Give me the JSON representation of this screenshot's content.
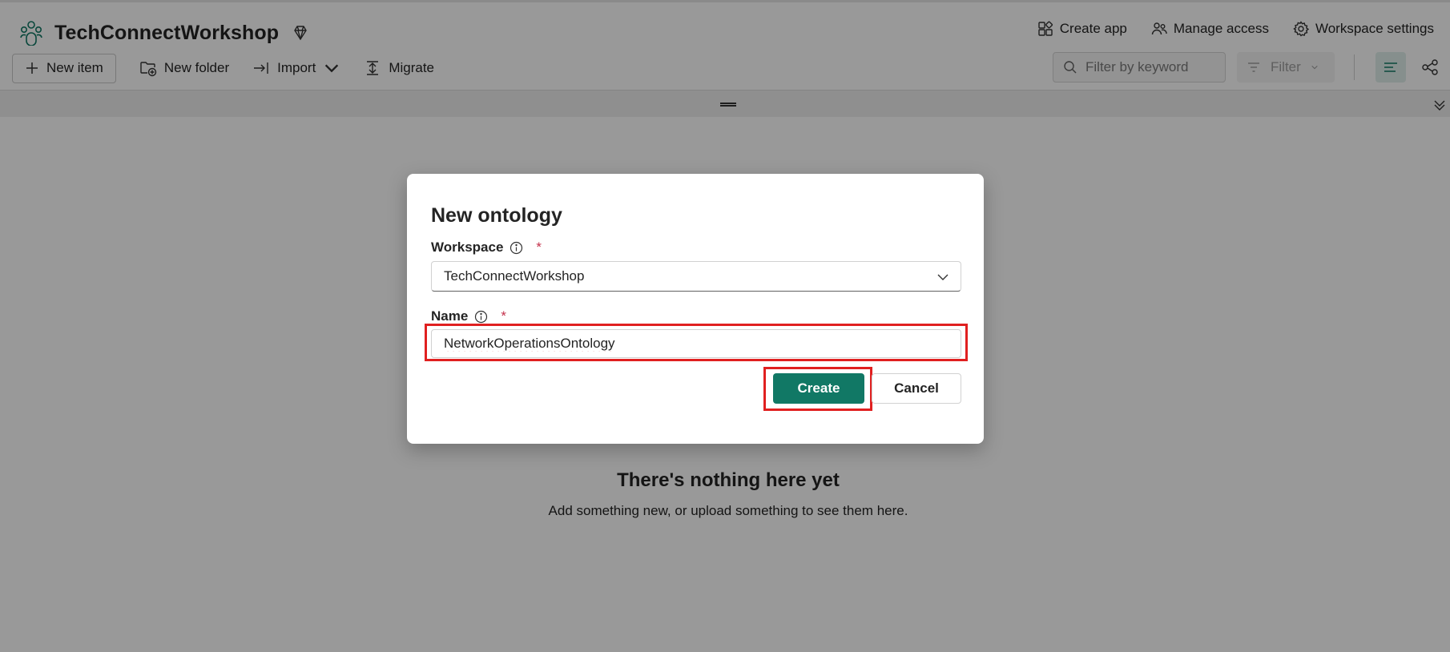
{
  "workspace": {
    "title": "TechConnectWorkshop",
    "logo_icon": "workspace-people-icon",
    "premium_icon": "diamond-icon"
  },
  "header_actions": [
    {
      "label": "Create app",
      "icon": "app-grid-icon"
    },
    {
      "label": "Manage access",
      "icon": "people-icon"
    },
    {
      "label": "Workspace settings",
      "icon": "gear-icon"
    }
  ],
  "toolbar": {
    "new_item": "New item",
    "new_folder": "New folder",
    "import": "Import",
    "migrate": "Migrate"
  },
  "search": {
    "placeholder": "Filter by keyword"
  },
  "filter": {
    "label": "Filter"
  },
  "empty_state": {
    "title": "There's nothing here yet",
    "subtitle": "Add something new, or upload something to see them here."
  },
  "dialog": {
    "title": "New ontology",
    "workspace_label": "Workspace",
    "workspace_required": "*",
    "workspace_value": "TechConnectWorkshop",
    "name_label": "Name",
    "name_required": "*",
    "name_value": "NetworkOperationsOntology",
    "create_label": "Create",
    "cancel_label": "Cancel"
  },
  "colors": {
    "accent": "#117865",
    "highlight": "#e02020",
    "required": "#c4314b"
  }
}
